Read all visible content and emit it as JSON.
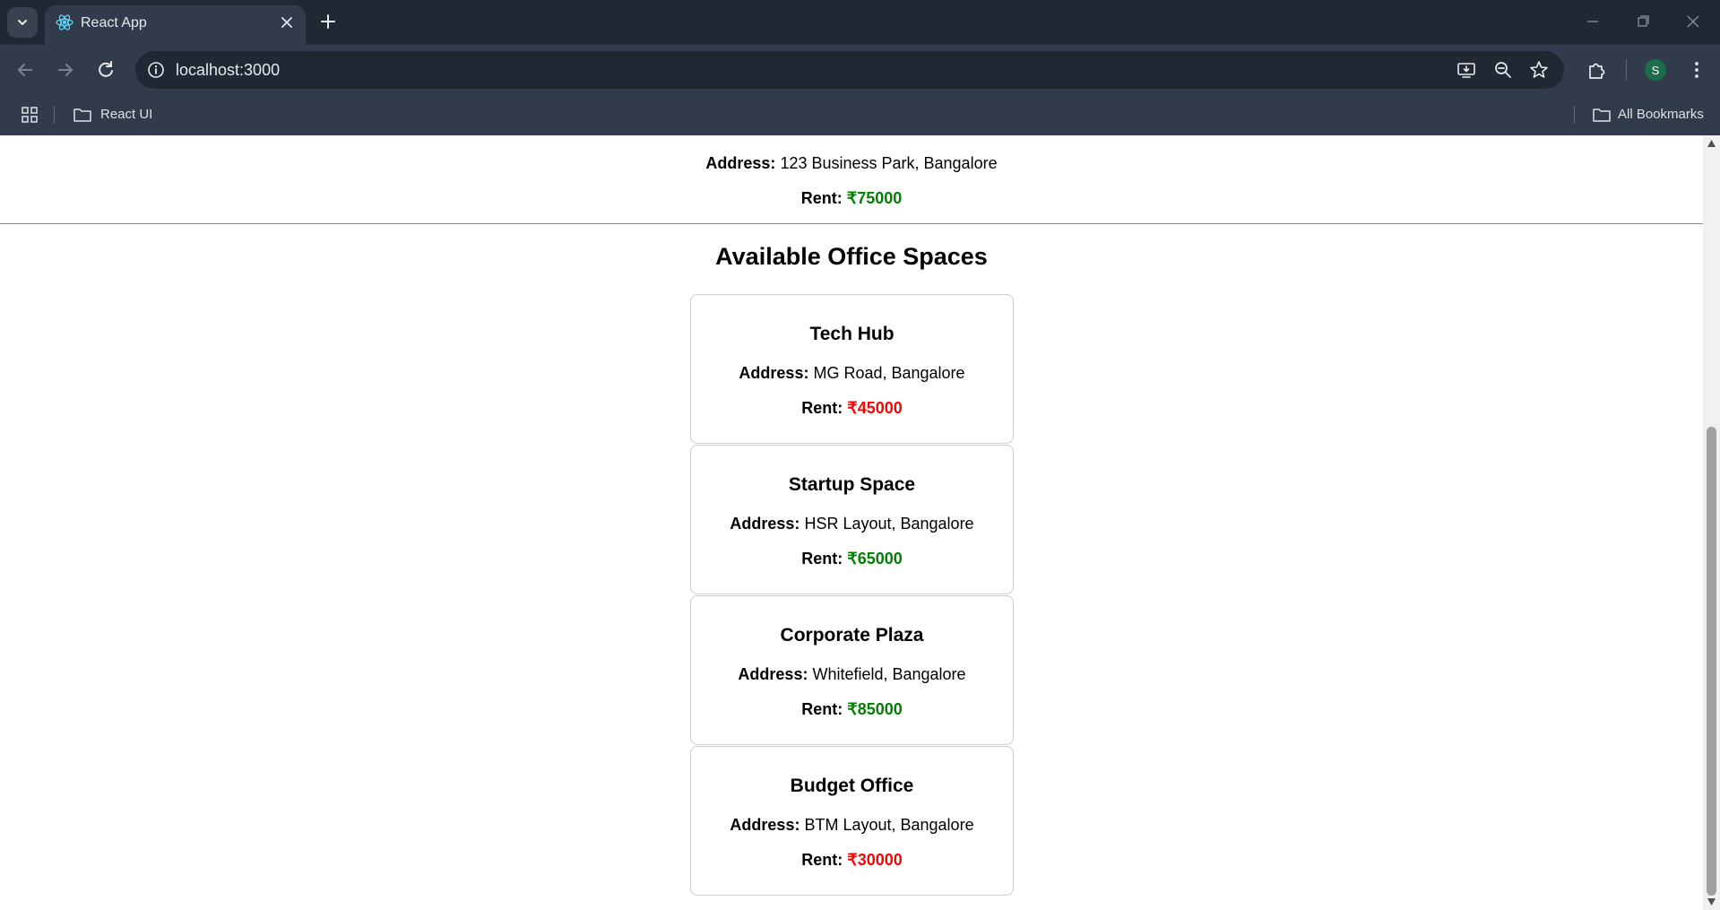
{
  "browser": {
    "tab_title": "React App",
    "url": "localhost:3000",
    "profile_initial": "S",
    "bookmarks": [
      {
        "label": "React UI"
      }
    ],
    "all_bookmarks_label": "All Bookmarks"
  },
  "page": {
    "selected_office": {
      "address_label": "Address:",
      "address": "123 Business Park, Bangalore",
      "rent_label": "Rent:",
      "rent": "₹75000",
      "rent_color": "#008000"
    },
    "heading": "Available Office Spaces",
    "offices": [
      {
        "name": "Tech Hub",
        "address_label": "Address:",
        "address": "MG Road, Bangalore",
        "rent_label": "Rent:",
        "rent": "₹45000",
        "rent_color": "#ff0000"
      },
      {
        "name": "Startup Space",
        "address_label": "Address:",
        "address": "HSR Layout, Bangalore",
        "rent_label": "Rent:",
        "rent": "₹65000",
        "rent_color": "#008000"
      },
      {
        "name": "Corporate Plaza",
        "address_label": "Address:",
        "address": "Whitefield, Bangalore",
        "rent_label": "Rent:",
        "rent": "₹85000",
        "rent_color": "#008000"
      },
      {
        "name": "Budget Office",
        "address_label": "Address:",
        "address": "BTM Layout, Bangalore",
        "rent_label": "Rent:",
        "rent": "₹30000",
        "rent_color": "#ff0000"
      }
    ]
  },
  "colors": {
    "tabstrip_bg": "#222833",
    "toolbar_bg": "#323b4b",
    "rent_high": "#008000",
    "rent_low": "#ff0000"
  },
  "icons": {
    "tab_search": "chevron-down-icon",
    "favicon": "react-logo-icon",
    "close_tab": "close-icon",
    "new_tab": "plus-icon",
    "back": "arrow-left-icon",
    "forward": "arrow-right-icon",
    "reload": "reload-icon",
    "site_info": "info-icon",
    "install": "install-app-icon",
    "zoom": "zoom-out-icon",
    "bookmark": "star-icon",
    "extensions": "puzzle-icon",
    "menu": "kebab-menu-icon",
    "apps": "apps-grid-icon",
    "folder": "folder-icon"
  }
}
